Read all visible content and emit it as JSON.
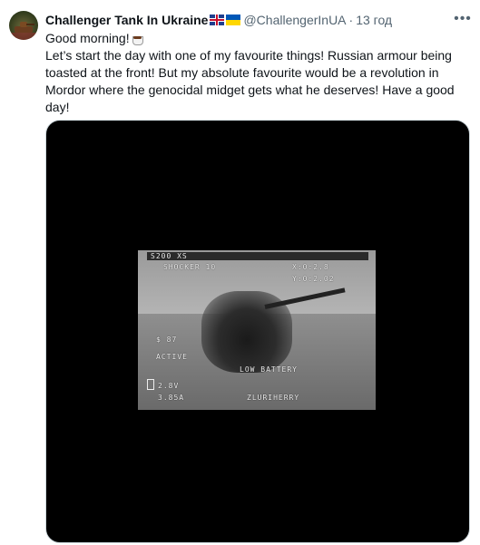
{
  "tweet": {
    "display_name": "Challenger Tank In Ukraine",
    "handle": "@ChallengerInUA",
    "separator": "·",
    "time": "13 год",
    "text_line1": "Good morning!",
    "text_body": "Let’s start the day with one of my favourite things! Russian armour being toasted at the front! But my absolute favourite would be a revolution in Mordor where the genocidal midget gets what he deserves! Have a good day!",
    "more_icon": "more-icon",
    "emoji_icons": [
      "flag-uk-icon",
      "flag-ua-icon",
      "coffee-cup-icon"
    ]
  },
  "video_hud": {
    "top": "S200 XS",
    "line2_left": "SHOCKER 10",
    "line2_right": "X:0:2.8",
    "line3_right": "Y:0:2.02",
    "alt": "$ 87",
    "mode": "ACTIVE",
    "low_battery": "LOW BATTERY",
    "voltage1": "2.8V",
    "voltage2": "3.85A",
    "recording": "ZLURIHERRY"
  }
}
